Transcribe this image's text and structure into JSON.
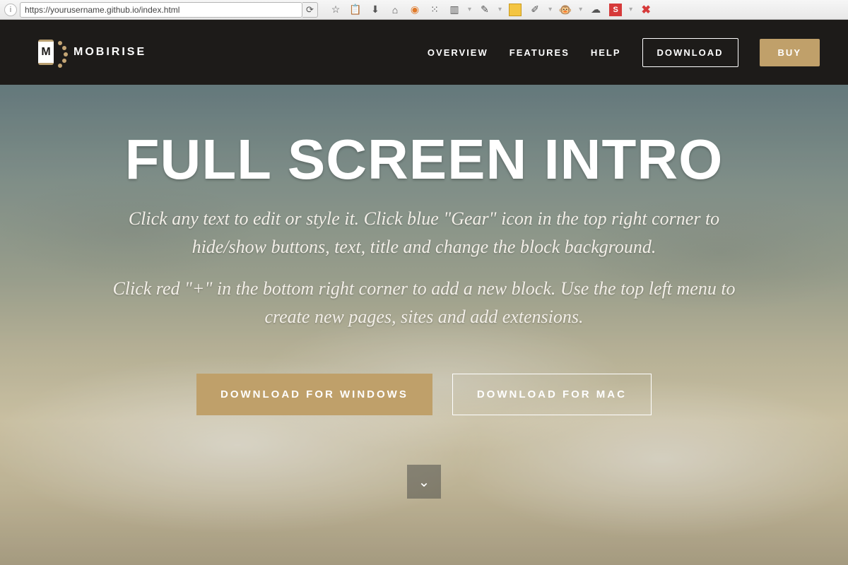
{
  "browser": {
    "url_display": "https://yourusername.github.io/index.html"
  },
  "header": {
    "brand": "MOBIRISE",
    "logo_letter": "M",
    "nav": {
      "overview": "OVERVIEW",
      "features": "FEATURES",
      "help": "HELP",
      "download": "DOWNLOAD",
      "buy": "BUY"
    }
  },
  "hero": {
    "title": "FULL SCREEN INTRO",
    "para1": "Click any text to edit or style it. Click blue \"Gear\" icon in the top right corner to hide/show buttons, text, title and change the block background.",
    "para2": "Click red \"+\" in the bottom right corner to add a new block. Use the top left menu to create new pages, sites and add extensions.",
    "cta_windows": "DOWNLOAD FOR WINDOWS",
    "cta_mac": "DOWNLOAD FOR MAC"
  }
}
